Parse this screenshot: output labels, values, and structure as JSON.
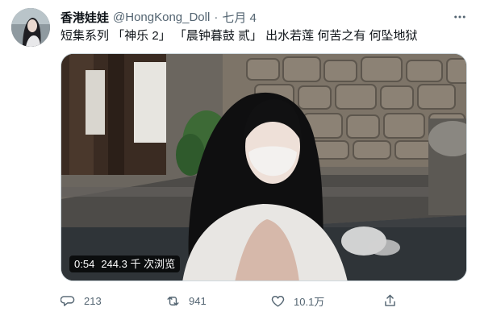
{
  "author": {
    "display_name": "香港娃娃",
    "handle": "@HongKong_Doll",
    "separator": "·",
    "date": "七月 4"
  },
  "tweet": {
    "text": "短集系列 「神乐 2」 「晨钟暮鼓 贰」 出水若莲 何苦之有 何坠地狱"
  },
  "video": {
    "duration": "0:54",
    "views": "244.3 千 次浏览"
  },
  "actions": {
    "reply_count": "213",
    "retweet_count": "941",
    "like_count": "10.1万"
  },
  "icons": {
    "more": "more-dots-icon",
    "reply": "reply-bubble-icon",
    "retweet": "retweet-icon",
    "like": "heart-icon",
    "share": "share-icon"
  },
  "colors": {
    "text_primary": "#0f1419",
    "text_secondary": "#536471",
    "border": "#cfd9de"
  }
}
